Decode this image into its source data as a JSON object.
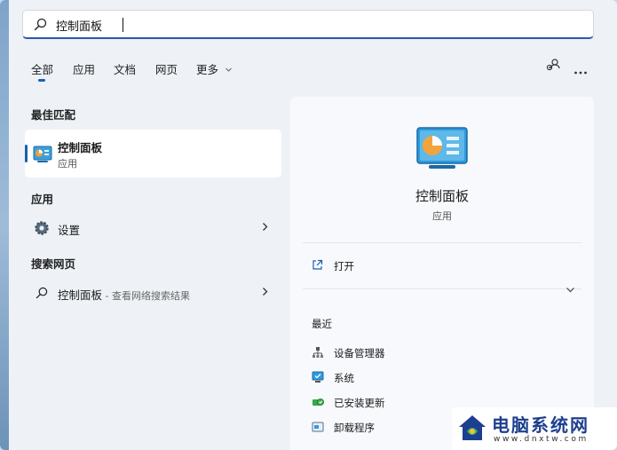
{
  "search": {
    "value": "控制面板"
  },
  "tabs": [
    {
      "label": "全部",
      "active": true
    },
    {
      "label": "应用"
    },
    {
      "label": "文档"
    },
    {
      "label": "网页"
    },
    {
      "label": "更多"
    }
  ],
  "sections": {
    "best_match": "最佳匹配",
    "apps": "应用",
    "web": "搜索网页"
  },
  "best_match": {
    "title": "控制面板",
    "subtitle": "应用"
  },
  "apps": [
    {
      "label": "设置"
    }
  ],
  "web": [
    {
      "label": "控制面板",
      "hint": " - 查看网络搜索结果"
    }
  ],
  "preview": {
    "title": "控制面板",
    "type": "应用",
    "open_label": "打开",
    "recent_label": "最近",
    "recent": [
      {
        "label": "设备管理器",
        "icon": "device-manager-icon"
      },
      {
        "label": "系统",
        "icon": "system-icon"
      },
      {
        "label": "已安装更新",
        "icon": "installed-updates-icon"
      },
      {
        "label": "卸载程序",
        "icon": "uninstall-program-icon"
      }
    ]
  },
  "watermark": {
    "brand": "电脑系统网",
    "url": "www.dnxtw.com"
  },
  "colors": {
    "accent": "#1a5fb4",
    "panel": "#eef2f7",
    "card": "#ffffff"
  }
}
